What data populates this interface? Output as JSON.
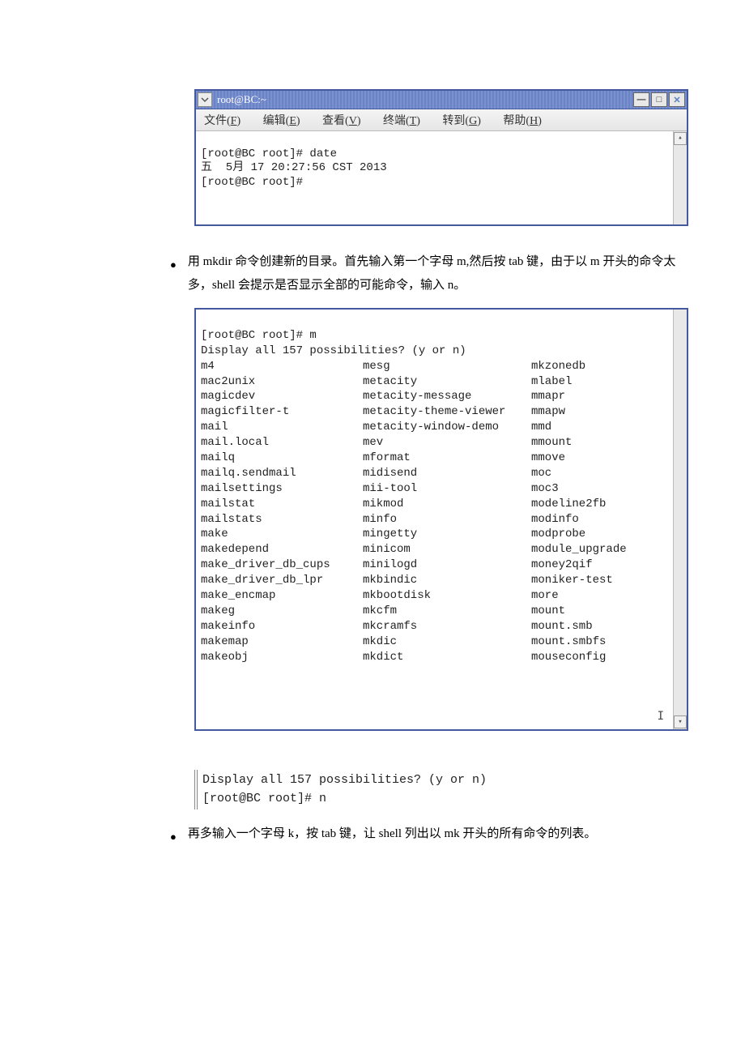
{
  "win1": {
    "title": "root@BC:~",
    "menus": [
      "文件(F)",
      "编辑(E)",
      "查看(V)",
      "终端(T)",
      "转到(G)",
      "帮助(H)"
    ],
    "lines": [
      "[root@BC root]# date",
      "五  5月 17 20:27:56 CST 2013",
      "[root@BC root]#"
    ]
  },
  "bullet1": "用 mkdir 命令创建新的目录。首先输入第一个字母 m,然后按 tab 键，由于以 m 开头的命令太多，shell 会提示是否显示全部的可能命令，输入 n。",
  "tab": {
    "pre": [
      "[root@BC root]# m",
      "Display all 157 possibilities? (y or n)"
    ],
    "rows": [
      [
        "m4",
        "mesg",
        "mkzonedb"
      ],
      [
        "mac2unix",
        "metacity",
        "mlabel"
      ],
      [
        "magicdev",
        "metacity-message",
        "mmapr"
      ],
      [
        "magicfilter-t",
        "metacity-theme-viewer",
        "mmapw"
      ],
      [
        "mail",
        "metacity-window-demo",
        "mmd"
      ],
      [
        "mail.local",
        "mev",
        "mmount"
      ],
      [
        "mailq",
        "mformat",
        "mmove"
      ],
      [
        "mailq.sendmail",
        "midisend",
        "moc"
      ],
      [
        "mailsettings",
        "mii-tool",
        "moc3"
      ],
      [
        "mailstat",
        "mikmod",
        "modeline2fb"
      ],
      [
        "mailstats",
        "minfo",
        "modinfo"
      ],
      [
        "make",
        "mingetty",
        "modprobe"
      ],
      [
        "makedepend",
        "minicom",
        "module_upgrade"
      ],
      [
        "make_driver_db_cups",
        "minilogd",
        "money2qif"
      ],
      [
        "make_driver_db_lpr",
        "mkbindic",
        "moniker-test"
      ],
      [
        "make_encmap",
        "mkbootdisk",
        "more"
      ],
      [
        "makeg",
        "mkcfm",
        "mount"
      ],
      [
        "makeinfo",
        "mkcramfs",
        "mount.smb"
      ],
      [
        "makemap",
        "mkdic",
        "mount.smbfs"
      ],
      [
        "makeobj",
        "mkdict",
        "mouseconfig"
      ]
    ]
  },
  "snippet": {
    "lines": [
      "Display all 157 possibilities? (y or n)",
      "[root@BC root]# n"
    ]
  },
  "bullet2": "再多输入一个字母 k，按 tab 键，让 shell 列出以 mk 开头的所有命令的列表。"
}
